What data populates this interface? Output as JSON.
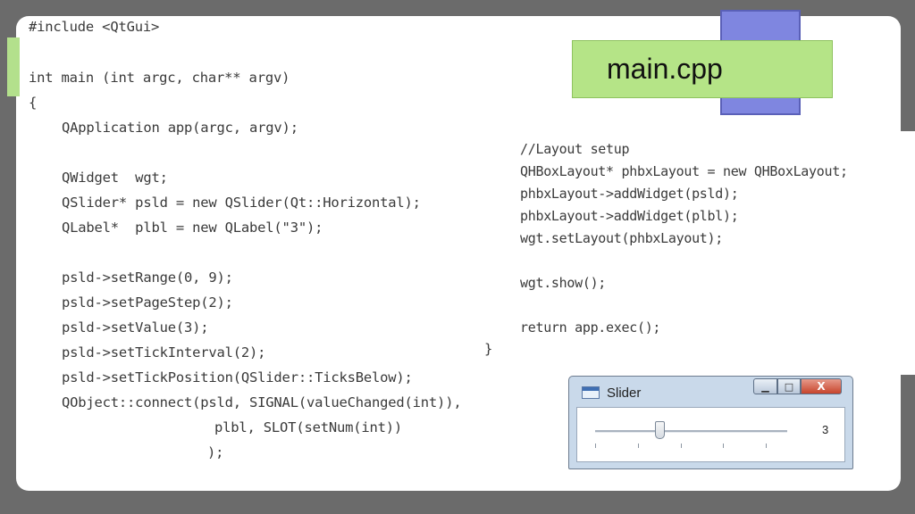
{
  "title": {
    "text": "main.cpp"
  },
  "code_left": [
    "#include <QtGui>",
    "int main (int argc, char** argv)",
    "{",
    "QApplication app(argc, argv);",
    "QWidget  wgt;",
    "QSlider* psld = new QSlider(Qt::Horizontal);",
    "QLabel*  plbl = new QLabel(\"3\");",
    "psld->setRange(0, 9);",
    "psld->setPageStep(2);",
    "psld->setValue(3);",
    "psld->setTickInterval(2);",
    "psld->setTickPosition(QSlider::TicksBelow);",
    "QObject::connect(psld, SIGNAL(valueChanged(int)),",
    "plbl, SLOT(setNum(int))",
    ");"
  ],
  "code_close_brace": "}",
  "code_right": [
    "//Layout setup",
    "QHBoxLayout* phbxLayout = new QHBoxLayout;",
    "phbxLayout->addWidget(psld);",
    "phbxLayout->addWidget(plbl);",
    "wgt.setLayout(phbxLayout);",
    "wgt.show();",
    "return app.exec();"
  ],
  "slider_window": {
    "title": "Slider",
    "min_button": "▁",
    "max_button": "□",
    "close_button": "X",
    "label_value": "3",
    "slider_min": 0,
    "slider_max": 9,
    "slider_value": 3,
    "tick_interval": 2
  }
}
